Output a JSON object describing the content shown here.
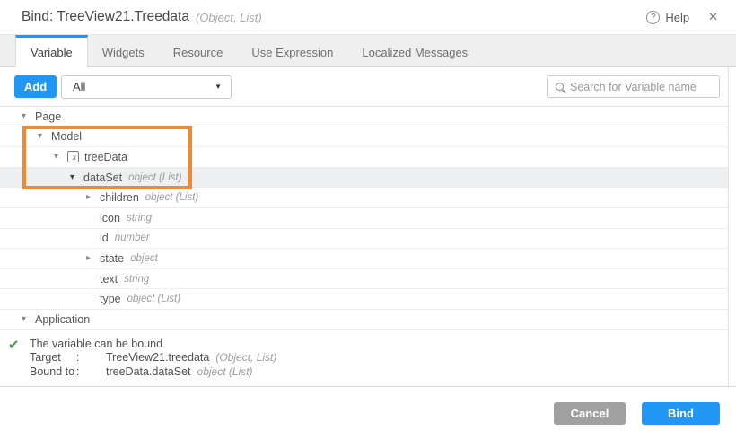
{
  "header": {
    "title": "Bind: TreeView21.Treedata",
    "title_suffix": "(Object, List)",
    "help_label": "Help"
  },
  "icons": {
    "help": "?",
    "close": "✕",
    "caret_down": "▼",
    "arrow_down": "▾",
    "arrow_right": "▸",
    "check": "✔",
    "variable": "x"
  },
  "tabs": [
    {
      "label": "Variable",
      "active": true
    },
    {
      "label": "Widgets",
      "active": false
    },
    {
      "label": "Resource",
      "active": false
    },
    {
      "label": "Use Expression",
      "active": false
    },
    {
      "label": "Localized Messages",
      "active": false
    }
  ],
  "toolbar": {
    "add_label": "Add",
    "filter_value": "All",
    "search_placeholder": "Search for Variable name"
  },
  "tree": {
    "rows": [
      {
        "label": "Page",
        "type": "",
        "level": 0,
        "arrow": "down"
      },
      {
        "label": "Model",
        "type": "",
        "level": 1,
        "arrow": "down"
      },
      {
        "label": "treeData",
        "type": "",
        "level": 2,
        "arrow": "down",
        "icon": "variable"
      },
      {
        "label": "dataSet",
        "type": "object (List)",
        "level": 3,
        "arrow": "down-dark",
        "selected": true
      },
      {
        "label": "children",
        "type": "object (List)",
        "level": 4,
        "arrow": "right"
      },
      {
        "label": "icon",
        "type": "string",
        "level": 4,
        "arrow": null
      },
      {
        "label": "id",
        "type": "number",
        "level": 4,
        "arrow": null
      },
      {
        "label": "state",
        "type": "object",
        "level": 4,
        "arrow": "right"
      },
      {
        "label": "text",
        "type": "string",
        "level": 4,
        "arrow": null
      },
      {
        "label": "type",
        "type": "object (List)",
        "level": 4,
        "arrow": null
      },
      {
        "label": "Application",
        "type": "",
        "level": 0,
        "arrow": "down"
      }
    ]
  },
  "status": {
    "message": "The variable can be bound",
    "rows": [
      {
        "label": "Target",
        "colon": ":",
        "value": "TreeView21.treedata",
        "type": "(Object, List)"
      },
      {
        "label": "Bound to",
        "colon": ":",
        "value": "treeData.dataSet",
        "type": "object (List)"
      }
    ]
  },
  "footer": {
    "cancel_label": "Cancel",
    "bind_label": "Bind"
  },
  "colors": {
    "accent_blue": "#2196f3",
    "highlight_orange": "#ee8a31",
    "success_green": "#3da23d",
    "cancel_gray": "#a0a0a0"
  }
}
